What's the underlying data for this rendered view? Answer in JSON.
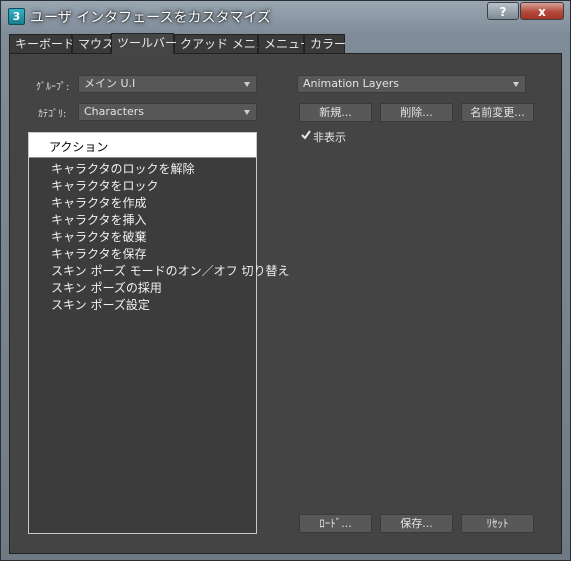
{
  "window": {
    "title": "ユーザ インタフェースをカスタマイズ",
    "icon_text": "3",
    "help_label": "?",
    "close_label": "x"
  },
  "tabs": [
    {
      "label": "キーボード"
    },
    {
      "label": "マウス"
    },
    {
      "label": "ツールバー",
      "active": true
    },
    {
      "label": "クアッド メニュー"
    },
    {
      "label": "メニュー"
    },
    {
      "label": "カラー"
    }
  ],
  "left": {
    "group_label": "ｸﾞﾙｰﾌﾟ:",
    "group_value": "メイン U.I",
    "category_label": "ｶﾃｺﾞﾘ:",
    "category_value": "Characters",
    "list_header": "アクション",
    "actions": [
      "キャラクタのロックを解除",
      "キャラクタをロック",
      "キャラクタを作成",
      "キャラクタを挿入",
      "キャラクタを破棄",
      "キャラクタを保存",
      "スキン ポーズ モードのオン／オフ 切り替え",
      "スキン ポーズの採用",
      "スキン ポーズ設定"
    ]
  },
  "right": {
    "toolbar_value": "Animation Layers",
    "new_label": "新規...",
    "delete_label": "削除...",
    "rename_label": "名前変更...",
    "hide_label": "非表示",
    "hide_checked": true
  },
  "footer": {
    "load_label": "ﾛｰﾄﾞ...",
    "save_label": "保存...",
    "reset_label": "ﾘｾｯﾄ"
  }
}
